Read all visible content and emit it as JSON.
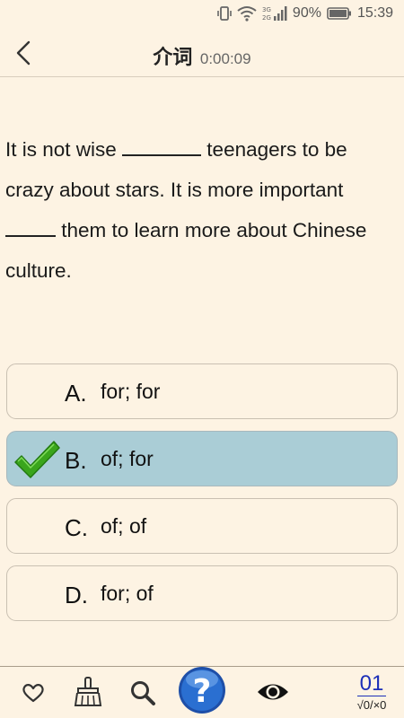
{
  "status_bar": {
    "network": "3G\n2G",
    "battery_percent": "90%",
    "time": "15:39"
  },
  "header": {
    "title": "介词",
    "timer": "0:00:09"
  },
  "question": {
    "part1": "It is not wise ",
    "part2": " teenagers to be crazy about stars. It is more important ",
    "part3": " them to learn more about Chinese culture."
  },
  "options": [
    {
      "letter": "A.",
      "text": "for; for",
      "selected": false
    },
    {
      "letter": "B.",
      "text": "of; for",
      "selected": true
    },
    {
      "letter": "C.",
      "text": "of; of",
      "selected": false
    },
    {
      "letter": "D.",
      "text": "for; of",
      "selected": false
    }
  ],
  "bottom_bar": {
    "icons": [
      "heart-icon",
      "broom-icon",
      "search-icon",
      "help-icon",
      "eye-icon"
    ],
    "question_number": "01",
    "score": "√0/×0"
  },
  "colors": {
    "background": "#fdf3e3",
    "selected_option": "#aacdd6",
    "counter_blue": "#1c2fb8",
    "check_green": "#3aa51c",
    "help_blue": "#2a6fd1"
  }
}
